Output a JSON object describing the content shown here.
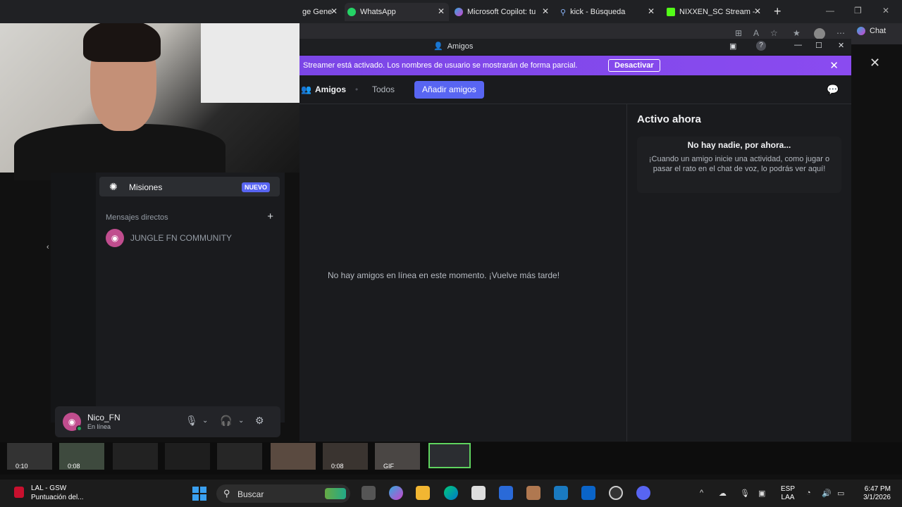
{
  "browser": {
    "tabs": [
      {
        "label": "ge Gene",
        "icon": "generic-icon"
      },
      {
        "label": "WhatsApp",
        "icon": "whatsapp-icon"
      },
      {
        "label": "Microsoft Copilot: tu",
        "icon": "copilot-icon"
      },
      {
        "label": "kick - Búsqueda",
        "icon": "search-icon"
      },
      {
        "label": "NIXXEN_SC Stream -",
        "icon": "kick-icon"
      }
    ],
    "chat_label": "Chat"
  },
  "discord": {
    "title": "Amigos",
    "banner_message": "Streamer está activado. Los nombres de usuario se mostrarán de forma parcial.",
    "banner_button": "Desactivar",
    "nav": {
      "friends": "Amigos",
      "all": "Todos",
      "add": "Añadir amigos"
    },
    "empty_message": "No hay amigos en línea en este momento. ¡Vuelve más tarde!",
    "active_now": {
      "title": "Activo ahora",
      "heading": "No hay nadie, por ahora...",
      "body": "¡Cuando un amigo inicie una actividad, como jugar o pasar el rato en el chat de voz, lo podrás ver aquí!"
    },
    "missions": {
      "label": "Misiones",
      "badge": "NUEVO"
    },
    "dm_header": "Mensajes directos",
    "dm_items": [
      {
        "name": "JUNGLE FN COMMUNITY"
      }
    ],
    "user": {
      "name": "Nico_FN",
      "status": "En línea"
    }
  },
  "media_strip": [
    {
      "time": "0:10"
    },
    {
      "time": "0:08"
    },
    {
      "time": ""
    },
    {
      "time": ""
    },
    {
      "time": ""
    },
    {
      "time": ""
    },
    {
      "time": "0:08"
    },
    {
      "time": "GIF"
    },
    {
      "time": ""
    }
  ],
  "taskbar": {
    "weather_title": "LAL - GSW",
    "weather_sub": "Puntuación del...",
    "search_label": "Buscar",
    "lang_line1": "ESP",
    "lang_line2": "LAA",
    "time": "6:47 PM",
    "date": "3/1/2026"
  },
  "colors": {
    "accent": "#5865f2",
    "banner": "#8a4bf0",
    "online": "#23a55a"
  }
}
